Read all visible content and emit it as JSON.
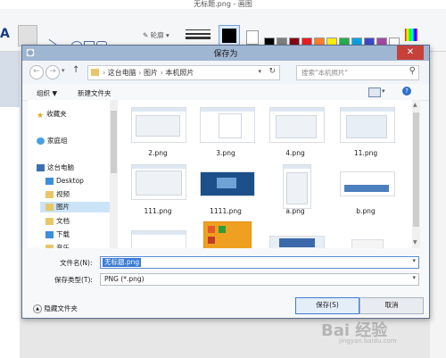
{
  "paint": {
    "window_title": "无标题.png - 画图",
    "outline_label": "轮廓",
    "color_swatches": [
      "#000000",
      "#7f7f7f",
      "#880015",
      "#ed1c24",
      "#ff7f27",
      "#fff200",
      "#22b14c",
      "#00a2e8",
      "#3f48cc",
      "#a349a4",
      "#ffffff"
    ]
  },
  "dialog": {
    "title": "保存为",
    "breadcrumb": [
      "这台电脑",
      "图片",
      "本机照片"
    ],
    "search_placeholder": "搜索\"本机照片\"",
    "toolbar": {
      "organize": "组织 ▼",
      "new_folder": "新建文件夹"
    },
    "nav_items": [
      {
        "label": "收藏夹",
        "icon": "star-icon"
      },
      {
        "label": "家庭组",
        "icon": "homegroup-icon"
      },
      {
        "label": "这台电脑",
        "icon": "computer-icon"
      },
      {
        "label": "Desktop",
        "icon": "folder-icon"
      },
      {
        "label": "视频",
        "icon": "folder-icon"
      },
      {
        "label": "图片",
        "icon": "folder-icon"
      },
      {
        "label": "文档",
        "icon": "folder-icon"
      },
      {
        "label": "下载",
        "icon": "folder-icon"
      },
      {
        "label": "音乐",
        "icon": "folder-icon"
      }
    ],
    "files": [
      "",
      "2.png",
      "3.png",
      "4.png",
      "11.png",
      "111.png",
      "1111.png",
      "a.png",
      "b.png",
      "",
      "",
      "",
      ""
    ],
    "file_name_label": "文件名(N):",
    "file_name_value": "无标题.png",
    "file_type_label": "保存类型(T):",
    "file_type_value": "PNG (*.png)",
    "hide_folders": "隐藏文件夹",
    "save_label": "保存(S)",
    "cancel_label": "取消"
  },
  "watermark": {
    "brand": "Bai 经验",
    "url": "jingyan.baidu.com"
  }
}
